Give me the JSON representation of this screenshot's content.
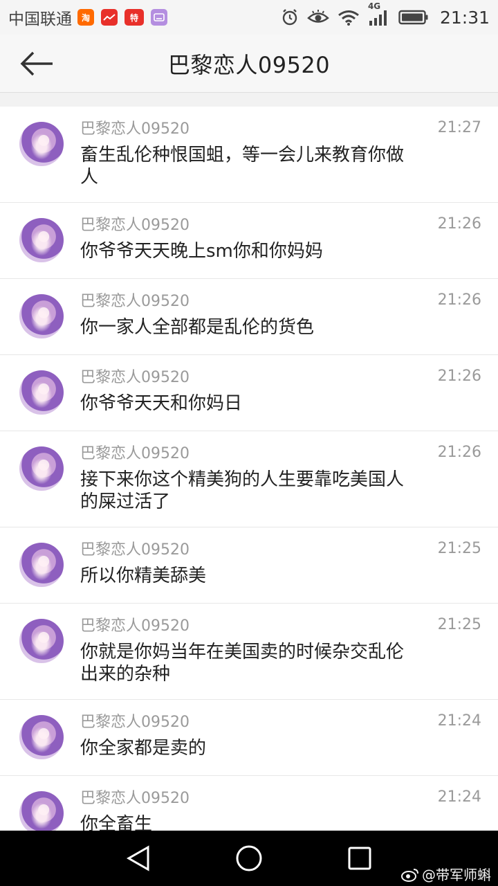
{
  "status_bar": {
    "carrier": "中国联通",
    "network": "4G",
    "time": "21:31",
    "app_icons": [
      "taobao-icon",
      "stock-icon",
      "temai-icon",
      "keyboard-icon"
    ]
  },
  "header": {
    "title": "巴黎恋人09520"
  },
  "messages": [
    {
      "sender": "巴黎恋人09520",
      "time": "21:27",
      "text": "畜生乱伦种恨国蛆，等一会儿来教育你做人"
    },
    {
      "sender": "巴黎恋人09520",
      "time": "21:26",
      "text": "你爷爷天天晚上sm你和你妈妈"
    },
    {
      "sender": "巴黎恋人09520",
      "time": "21:26",
      "text": "你一家人全部都是乱伦的货色"
    },
    {
      "sender": "巴黎恋人09520",
      "time": "21:26",
      "text": "你爷爷天天和你妈日"
    },
    {
      "sender": "巴黎恋人09520",
      "time": "21:26",
      "text": "接下来你这个精美狗的人生要靠吃美国人的屎过活了"
    },
    {
      "sender": "巴黎恋人09520",
      "time": "21:25",
      "text": "所以你精美舔美"
    },
    {
      "sender": "巴黎恋人09520",
      "time": "21:25",
      "text": "你就是你妈当年在美国卖的时候杂交乱伦出来的杂种"
    },
    {
      "sender": "巴黎恋人09520",
      "time": "21:24",
      "text": "你全家都是卖的"
    },
    {
      "sender": "巴黎恋人09520",
      "time": "21:24",
      "text": "你全畜生"
    }
  ],
  "watermark": {
    "text": "@带军师蝌"
  },
  "colors": {
    "background": "#f2f2f2",
    "list_background": "#ffffff",
    "secondary_text": "#9a9a9a",
    "primary_text": "#222222",
    "nav_bar": "#000000"
  }
}
